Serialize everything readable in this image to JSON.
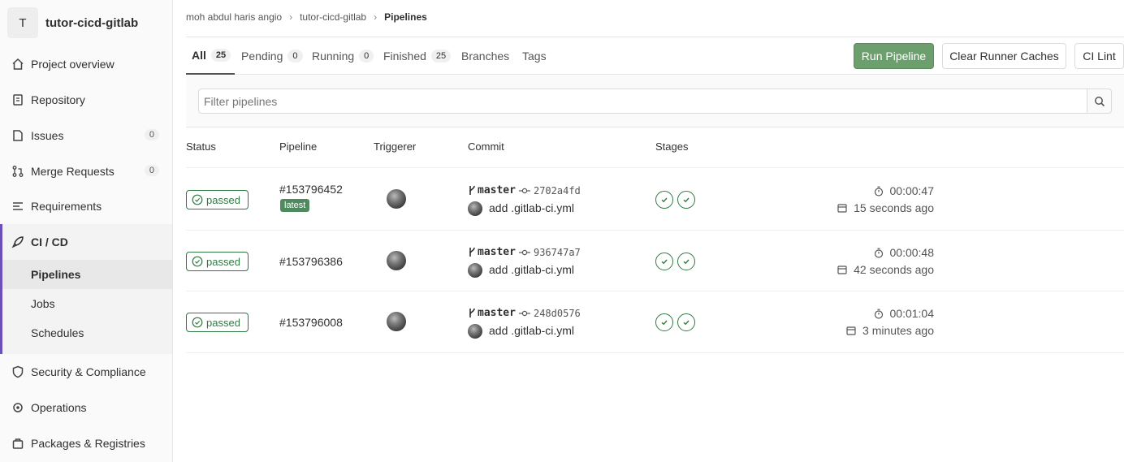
{
  "project": {
    "initial": "T",
    "name": "tutor-cicd-gitlab"
  },
  "sidebar": {
    "items": [
      {
        "label": "Project overview"
      },
      {
        "label": "Repository"
      },
      {
        "label": "Issues",
        "count": "0"
      },
      {
        "label": "Merge Requests",
        "count": "0"
      },
      {
        "label": "Requirements"
      },
      {
        "label": "CI / CD"
      },
      {
        "label": "Security & Compliance"
      },
      {
        "label": "Operations"
      },
      {
        "label": "Packages & Registries"
      }
    ],
    "cicd_sub": [
      {
        "label": "Pipelines"
      },
      {
        "label": "Jobs"
      },
      {
        "label": "Schedules"
      }
    ]
  },
  "breadcrumb": [
    "moh abdul haris angio",
    "tutor-cicd-gitlab",
    "Pipelines"
  ],
  "tabs": [
    {
      "label": "All",
      "count": "25"
    },
    {
      "label": "Pending",
      "count": "0"
    },
    {
      "label": "Running",
      "count": "0"
    },
    {
      "label": "Finished",
      "count": "25"
    },
    {
      "label": "Branches"
    },
    {
      "label": "Tags"
    }
  ],
  "buttons": {
    "run_pipeline": "Run Pipeline",
    "clear_caches": "Clear Runner Caches",
    "ci_lint": "CI Lint"
  },
  "filter": {
    "placeholder": "Filter pipelines"
  },
  "table": {
    "headers": [
      "Status",
      "Pipeline",
      "Triggerer",
      "Commit",
      "Stages"
    ],
    "rows": [
      {
        "status": "passed",
        "id": "#153796452",
        "tag": "latest",
        "branch": "master",
        "sha": "2702a4fd",
        "message": "add .gitlab-ci.yml",
        "duration": "00:00:47",
        "finished": "15 seconds ago"
      },
      {
        "status": "passed",
        "id": "#153796386",
        "branch": "master",
        "sha": "936747a7",
        "message": "add .gitlab-ci.yml",
        "duration": "00:00:48",
        "finished": "42 seconds ago"
      },
      {
        "status": "passed",
        "id": "#153796008",
        "branch": "master",
        "sha": "248d0576",
        "message": "add .gitlab-ci.yml",
        "duration": "00:01:04",
        "finished": "3 minutes ago"
      }
    ]
  },
  "colors": {
    "success": "#2f7a43",
    "primary_button": "#6d9f6e",
    "active_nav_border": "#6b4fbb"
  }
}
